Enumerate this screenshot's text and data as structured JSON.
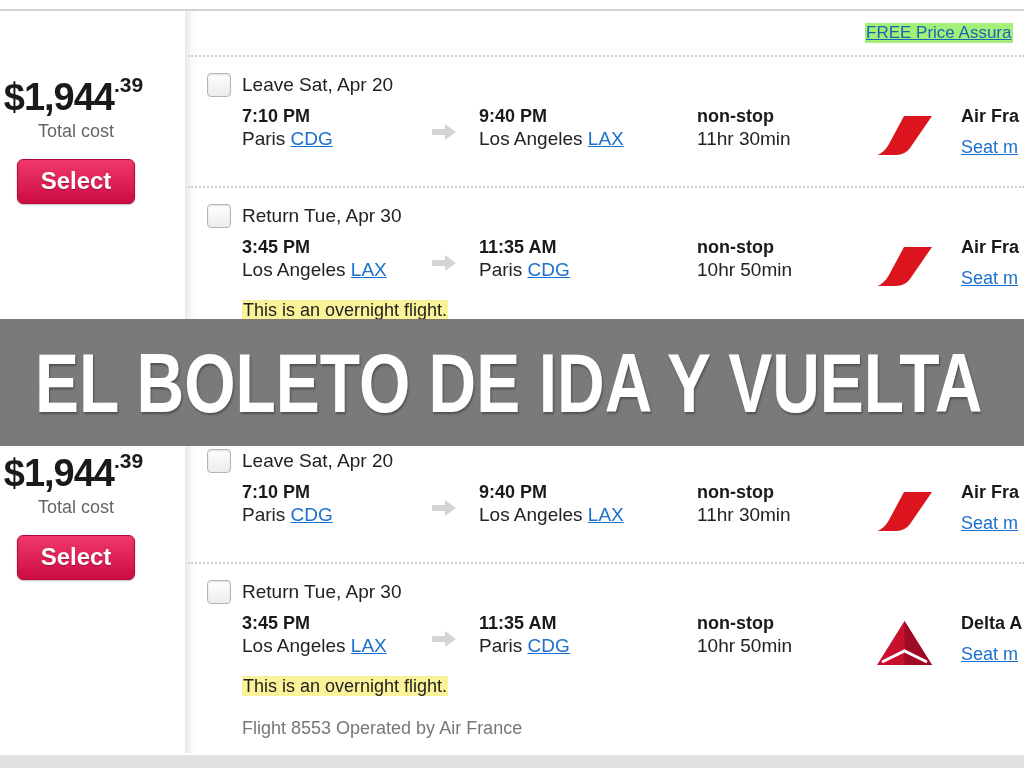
{
  "results": [
    {
      "price": "$1,944$^{.39}$",
      "price_label": "Total cost",
      "select_button": "Select",
      "promo_link": "FREE Price Assura",
      "segments": [
        {
          "label": "Leave Sat, Apr 20",
          "checked": false,
          "depart": {
            "time": "7:10 PM",
            "city": "Paris",
            "code": "CDG"
          },
          "arrive": {
            "time": "9:40 PM",
            "city": "Los Angeles",
            "code": "LAX"
          },
          "stops": "non-stop",
          "duration": "11hr 30min",
          "airline": {
            "kind": "stripe",
            "name": "Air Fra",
            "link": "Seat m"
          }
        },
        {
          "label": "Return Tue, Apr 30",
          "checked": false,
          "depart": {
            "time": "3:45 PM",
            "city": "Los Angeles",
            "code": "LAX"
          },
          "arrive": {
            "time": "11:35 AM",
            "city": "Paris",
            "code": "CDG"
          },
          "stops": "non-stop",
          "duration": "10hr 50min",
          "airline": {
            "kind": "stripe",
            "name": "Air Fra",
            "link": "Seat m"
          },
          "note": "This is an overnight flight."
        }
      ]
    },
    {
      "price": "$1,944$^{.39}$",
      "price_label": "Total cost",
      "select_button": "Select",
      "segments": [
        {
          "label": "Leave Sat, Apr 20",
          "checked": false,
          "depart": {
            "time": "7:10 PM",
            "city": "Paris",
            "code": "CDG"
          },
          "arrive": {
            "time": "9:40 PM",
            "city": "Los Angeles",
            "code": "LAX"
          },
          "stops": "non-stop",
          "duration": "11hr 30min",
          "airline": {
            "kind": "stripe",
            "name": "Air Fra",
            "link": "Seat m"
          }
        },
        {
          "label": "Return Tue, Apr 30",
          "checked": false,
          "depart": {
            "time": "3:45 PM",
            "city": "Los Angeles",
            "code": "LAX"
          },
          "arrive": {
            "time": "11:35 AM",
            "city": "Paris",
            "code": "CDG"
          },
          "stops": "non-stop",
          "duration": "10hr 50min",
          "airline": {
            "kind": "triangle",
            "name": "Delta A",
            "link": "Seat m"
          },
          "note": "This is an overnight flight.",
          "operated_by": "Flight 8553 Operated by Air France"
        }
      ]
    }
  ],
  "banner": {
    "title": "EL BOLETO DE IDA Y VUELTA"
  }
}
